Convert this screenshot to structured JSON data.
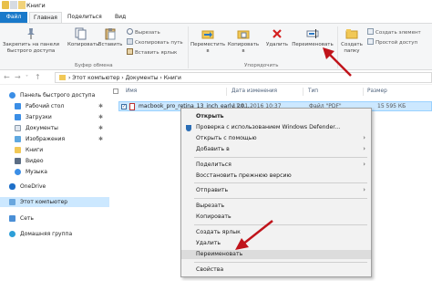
{
  "window": {
    "title": "Книги"
  },
  "tabs": [
    {
      "label": "Файл"
    },
    {
      "label": "Главная"
    },
    {
      "label": "Поделиться"
    },
    {
      "label": "Вид"
    }
  ],
  "ribbon": {
    "pin_label": "Закрепить на панели быстрого доступа",
    "copy_label": "Копировать",
    "paste_label": "Вставить",
    "cut_label": "Вырезать",
    "copy_path_label": "Скопировать путь",
    "paste_shortcut_label": "Вставить ярлык",
    "clipboard_group": "Буфер обмена",
    "move_to_label": "Переместить в",
    "copy_to_label": "Копировать в",
    "delete_label": "Удалить",
    "rename_label": "Переименовать",
    "organize_group": "Упорядочить",
    "new_folder_label": "Создать папку",
    "new_item_label": "Создать элемент",
    "easy_access_label": "Простой доступ"
  },
  "address": {
    "path": "›  Этот компьютер  ›  Документы  ›  Книги"
  },
  "nav": {
    "items": [
      {
        "label": "Панель быстрого доступа",
        "icon": "star-icon"
      },
      {
        "label": "Рабочий стол",
        "icon": "desktop-icon",
        "pinned": true
      },
      {
        "label": "Загрузки",
        "icon": "download-icon",
        "pinned": true
      },
      {
        "label": "Документы",
        "icon": "document-icon",
        "pinned": true
      },
      {
        "label": "Изображения",
        "icon": "pictures-icon",
        "pinned": true
      },
      {
        "label": "Книги",
        "icon": "folder-icon"
      },
      {
        "label": "Видео",
        "icon": "video-icon"
      },
      {
        "label": "Музыка",
        "icon": "music-icon"
      },
      {
        "label": "OneDrive",
        "icon": "cloud-icon"
      },
      {
        "label": "Этот компьютер",
        "icon": "computer-icon",
        "selected": true
      },
      {
        "label": "Сеть",
        "icon": "network-icon"
      },
      {
        "label": "Домашняя группа",
        "icon": "homegroup-icon"
      }
    ],
    "pin_glyph": "✱"
  },
  "columns": {
    "name": "Имя",
    "date": "Дата изменения",
    "type": "Тип",
    "size": "Размер"
  },
  "file": {
    "name": "macbook_pro_retina_13_inch_early_20...",
    "date": "11.01.2016 10:37",
    "type": "Файл \"PDF\"",
    "size": "15 595 КБ"
  },
  "context_menu": {
    "open": "Открыть",
    "defender": "Проверка с использованием Windows Defender...",
    "open_with": "Открыть с помощью",
    "add_to": "Добавить в",
    "share": "Поделиться",
    "restore": "Восстановить прежнюю версию",
    "send_to": "Отправить",
    "cut": "Вырезать",
    "copy": "Копировать",
    "create_shortcut": "Создать ярлык",
    "delete": "Удалить",
    "rename": "Переименовать",
    "properties": "Свойства"
  },
  "colors": {
    "accent": "#1979ca",
    "selection": "#cce8ff",
    "arrow": "#c0141b"
  }
}
